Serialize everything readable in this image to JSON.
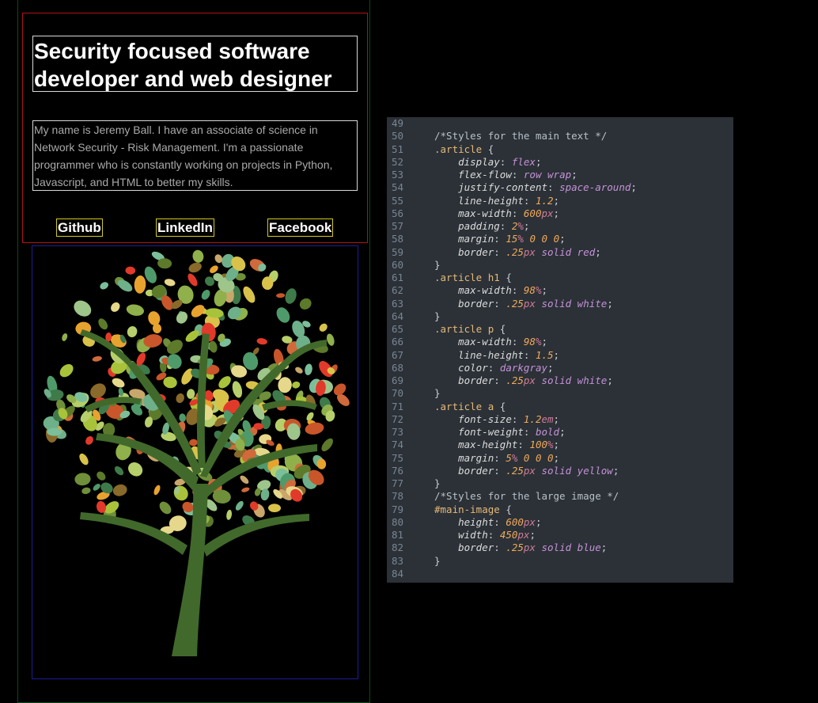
{
  "article": {
    "heading": "Security focused software developer and web designer",
    "paragraph": "My name is Jeremy Ball. I have an associate of science in Network Security - Risk Management. I'm a passionate programmer who is constantly working on projects in Python, Javascript, and HTML to better my skills.",
    "links": [
      "Github",
      "LinkedIn",
      "Facebook"
    ]
  },
  "image": {
    "icon": "leaf-tree-illustration"
  },
  "editor": {
    "colors": {
      "background": "#2b3137",
      "selector": "#e7b877",
      "value": "#c691d8",
      "number": "#f2a95a"
    },
    "lines": [
      {
        "n": "49",
        "text": ""
      },
      {
        "n": "50",
        "text": "/*Styles for the main text */"
      },
      {
        "n": "51",
        "text": ".article {"
      },
      {
        "n": "52",
        "text": "    display: flex;"
      },
      {
        "n": "53",
        "text": "    flex-flow: row wrap;"
      },
      {
        "n": "54",
        "text": "    justify-content: space-around;"
      },
      {
        "n": "55",
        "text": "    line-height: 1.2;"
      },
      {
        "n": "56",
        "text": "    max-width: 600px;"
      },
      {
        "n": "57",
        "text": "    padding: 2%;"
      },
      {
        "n": "58",
        "text": "    margin: 15% 0 0 0;"
      },
      {
        "n": "59",
        "text": "    border: .25px solid red;"
      },
      {
        "n": "60",
        "text": "}"
      },
      {
        "n": "61",
        "text": ".article h1 {"
      },
      {
        "n": "62",
        "text": "    max-width: 98%;"
      },
      {
        "n": "63",
        "text": "    border: .25px solid white;"
      },
      {
        "n": "64",
        "text": "}"
      },
      {
        "n": "65",
        "text": ".article p {"
      },
      {
        "n": "66",
        "text": "    max-width: 98%;"
      },
      {
        "n": "67",
        "text": "    line-height: 1.5;"
      },
      {
        "n": "68",
        "text": "    color: darkgray;"
      },
      {
        "n": "69",
        "text": "    border: .25px solid white;"
      },
      {
        "n": "70",
        "text": "}"
      },
      {
        "n": "71",
        "text": ".article a {"
      },
      {
        "n": "72",
        "text": "    font-size: 1.2em;"
      },
      {
        "n": "73",
        "text": "    font-weight: bold;"
      },
      {
        "n": "74",
        "text": "    max-height: 100%;"
      },
      {
        "n": "75",
        "text": "    margin: 5% 0 0 0;"
      },
      {
        "n": "76",
        "text": "    border: .25px solid yellow;"
      },
      {
        "n": "77",
        "text": "}"
      },
      {
        "n": "78",
        "text": "/*Styles for the large image */"
      },
      {
        "n": "79",
        "text": "#main-image {"
      },
      {
        "n": "80",
        "text": "    height: 600px;"
      },
      {
        "n": "81",
        "text": "    width: 450px;"
      },
      {
        "n": "82",
        "text": "    border: .25px solid blue;"
      },
      {
        "n": "83",
        "text": "}"
      },
      {
        "n": "84",
        "text": ""
      }
    ]
  }
}
